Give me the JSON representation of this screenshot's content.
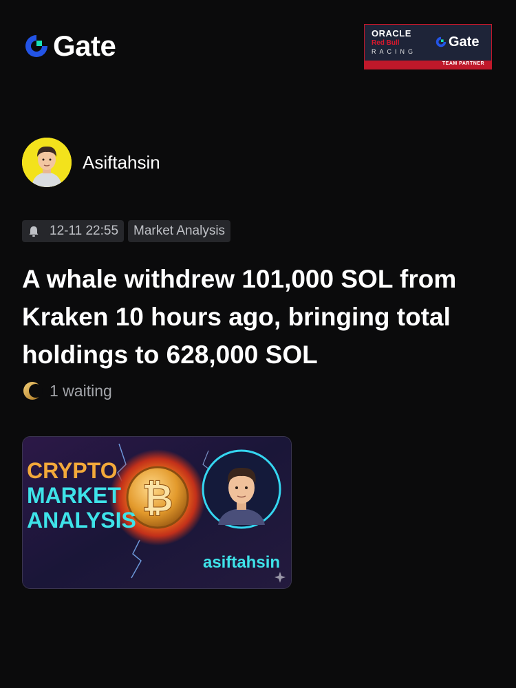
{
  "brand": {
    "name": "Gate",
    "accent": "#2354e6",
    "teal": "#17e2b8"
  },
  "partner_badge": {
    "oracle": "ORACLE",
    "redbull": "Red Bull",
    "racing": "RACING",
    "gate": "Gate",
    "strip": "TEAM PARTNER"
  },
  "author": {
    "name": "Asiftahsin"
  },
  "post": {
    "time": "12-11 22:55",
    "category": "Market Analysis",
    "title": "A whale withdrew 101,000 SOL from Kraken 10 hours ago, bringing total holdings to 628,000 SOL",
    "waiting": "1 waiting"
  },
  "thumbnail": {
    "line1": "CRYPTO",
    "line2": "MARKET",
    "line3": "ANALYSIS",
    "handle": "asiftahsin"
  }
}
